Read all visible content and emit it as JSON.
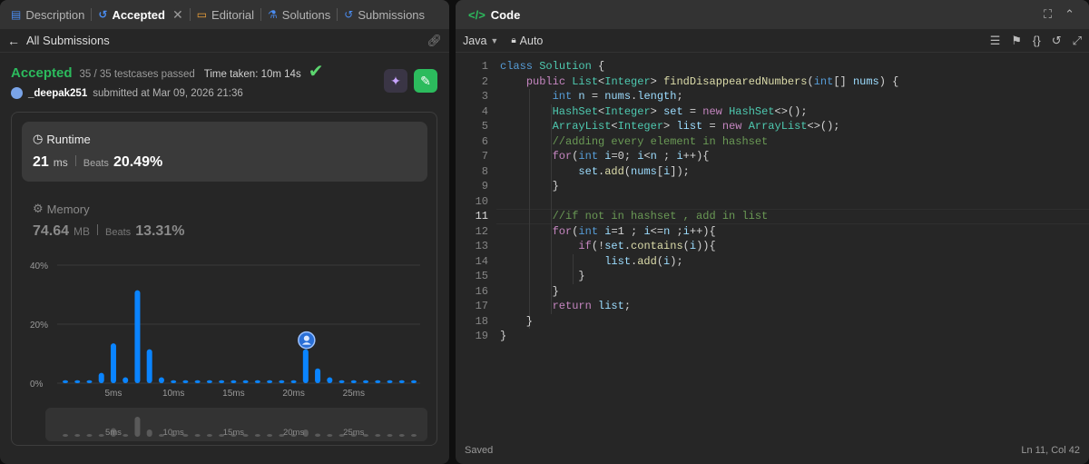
{
  "left_tabs": [
    {
      "label": "Description",
      "icon": "description-icon"
    },
    {
      "label": "Accepted",
      "icon": "history-icon"
    },
    {
      "label": "Editorial",
      "icon": "book-icon"
    },
    {
      "label": "Solutions",
      "icon": "flask-icon"
    },
    {
      "label": "Submissions",
      "icon": "history-icon"
    }
  ],
  "back_label": "All Submissions",
  "status": {
    "title": "Accepted",
    "testcases": "35 / 35 testcases passed",
    "time_taken": "Time taken: 10m 14s"
  },
  "user": {
    "name": "_deepak251",
    "submitted": "submitted at Mar 09, 2026 21:36"
  },
  "runtime": {
    "title": "Runtime",
    "value": "21",
    "unit": "ms",
    "beats_label": "Beats",
    "beats": "20.49%"
  },
  "memory": {
    "title": "Memory",
    "value": "74.64",
    "unit": "MB",
    "beats_label": "Beats",
    "beats": "13.31%"
  },
  "chart_data": {
    "type": "bar",
    "ylabel_ticks": [
      "40%",
      "20%",
      "0%"
    ],
    "ylim": [
      0,
      40
    ],
    "xticks": [
      {
        "label": "5ms",
        "value": 5
      },
      {
        "label": "10ms",
        "value": 10
      },
      {
        "label": "15ms",
        "value": 15
      },
      {
        "label": "20ms",
        "value": 20
      },
      {
        "label": "25ms",
        "value": 25
      }
    ],
    "x": [
      1,
      2,
      3,
      4,
      5,
      6,
      7,
      8,
      9,
      10,
      11,
      12,
      13,
      14,
      15,
      16,
      17,
      18,
      19,
      20,
      21,
      22,
      23,
      24,
      25,
      26,
      27,
      28,
      29,
      30
    ],
    "values": [
      1,
      1,
      1,
      3.5,
      13.5,
      2,
      31.5,
      11.5,
      2,
      1,
      1,
      1,
      1,
      1,
      1,
      1,
      1,
      1,
      1,
      1,
      11.5,
      5,
      2,
      1,
      1,
      1,
      1,
      1,
      1,
      1
    ],
    "highlight_x": 21,
    "grid": true,
    "bar_color": "#0a84ff",
    "mini_bar_color": "#5a5a5a"
  },
  "code_header": {
    "title": "Code",
    "language": "Java",
    "mode": "Auto"
  },
  "code_lines": [
    "class Solution {",
    "    public List<Integer> findDisappearedNumbers(int[] nums) {",
    "        int n = nums.length;",
    "        HashSet<Integer> set = new HashSet<>();",
    "        ArrayList<Integer> list = new ArrayList<>();",
    "        //adding every element in hashset",
    "        for(int i=0; i<n ; i++){",
    "            set.add(nums[i]);",
    "        }",
    "",
    "        //if not in hashset , add in list",
    "        for(int i=1 ; i<=n ;i++){",
    "            if(!set.contains(i)){",
    "                list.add(i);",
    "            }",
    "        }",
    "        return list;",
    "    }",
    "}"
  ],
  "current_line": 11,
  "footer": {
    "saved": "Saved",
    "cursor": "Ln 11, Col 42"
  },
  "colors": {
    "accepted": "#2cbb5d",
    "bar": "#0a84ff"
  }
}
